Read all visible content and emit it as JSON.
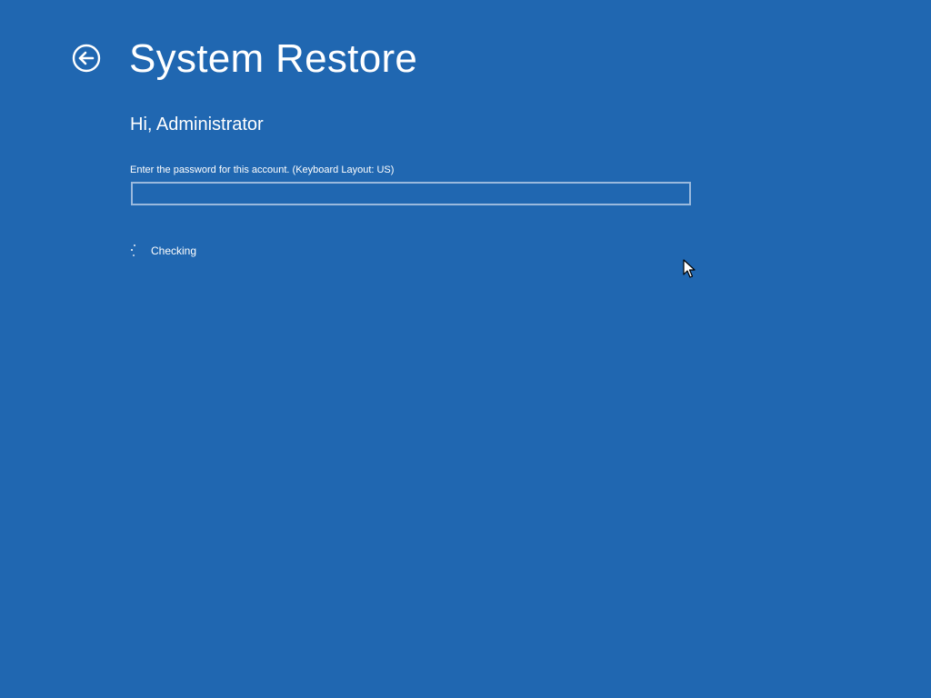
{
  "header": {
    "back_icon": "back-arrow-circle-icon",
    "title": "System Restore"
  },
  "account": {
    "greeting": "Hi, Administrator",
    "password_label": "Enter the password for this account. (Keyboard Layout: US)",
    "password_value": "",
    "password_placeholder": ""
  },
  "status": {
    "icon": "loading-spinner-icon",
    "text": "Checking"
  },
  "cursor": {
    "icon": "mouse-pointer-icon"
  },
  "colors": {
    "background": "#2067b1",
    "text": "#ffffff",
    "input_border": "#9ab9dd"
  }
}
